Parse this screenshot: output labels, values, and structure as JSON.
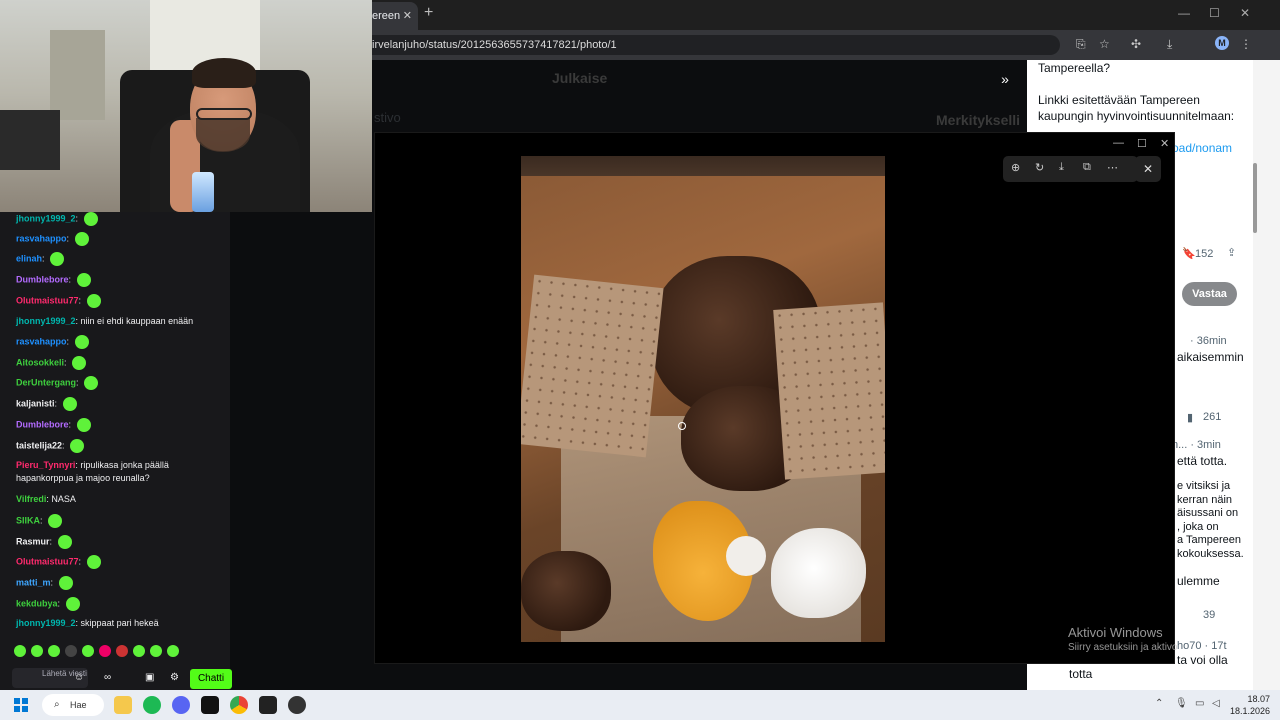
{
  "browser": {
    "tab_title": "ereen",
    "url": "irvelanjuho/status/2012563655737417821/photo/1",
    "avatar_letter": "M"
  },
  "page": {
    "header_left": "Julkaise",
    "header_right": "Merkitykselli",
    "side_text": "stivo"
  },
  "right_panel": {
    "line1": "Tampereella?",
    "line2": "Linkki esitettävään Tampereen kaupungin hyvinvointisuunnitelmaan:",
    "link": "oad/nonam",
    "bookmark_count": "152",
    "follow_button": "Vastaa",
    "reply1_meta": "· 36min",
    "reply1_text": "aikaisemmin",
    "views1": "261",
    "reply2_meta": "n... · 3min",
    "reply2_text": "että totta.",
    "reply3_text": "e vitsiksi ja\nkerran näin\näisussani on\n, joka on\na Tampereen\nkokouksessa.",
    "reply4_text": "ulemme",
    "views2": "39",
    "reply5_meta": "ho70 · 17t",
    "reply5_text": "ta voi olla",
    "reply5_text2": "totta"
  },
  "chat": {
    "messages": [
      {
        "user": "jhonny1999_2",
        "color": "#00b5ad",
        "text": ""
      },
      {
        "user": "rasvahappo",
        "color": "#1e90ff",
        "text": ""
      },
      {
        "user": "elinah",
        "color": "#1e90ff",
        "text": ""
      },
      {
        "user": "Dumblebore",
        "color": "#b36bff",
        "text": ""
      },
      {
        "user": "Olutmaistuu77",
        "color": "#ff2a6d",
        "text": ""
      },
      {
        "user": "jhonny1999_2",
        "color": "#00b5ad",
        "text": "niin ei ehdi kauppaan enään"
      },
      {
        "user": "rasvahappo",
        "color": "#1e90ff",
        "text": ""
      },
      {
        "user": "Aitosokkeli",
        "color": "#3ecf3e",
        "text": ""
      },
      {
        "user": "DerUntergang",
        "color": "#3ecf3e",
        "text": ""
      },
      {
        "user": "kaljanisti",
        "color": "#efeff1",
        "text": ""
      },
      {
        "user": "Dumblebore",
        "color": "#b36bff",
        "text": ""
      },
      {
        "user": "taistelija22",
        "color": "#efeff1",
        "text": ""
      },
      {
        "user": "Pieru_Tynnyri",
        "color": "#ff2a6d",
        "text": "ripulikasa jonka päällä hapankorppua ja majoo reunalla?"
      },
      {
        "user": "Vilfredi",
        "color": "#3ecf3e",
        "text": "NASA"
      },
      {
        "user": "SIIKA",
        "color": "#3ecf3e",
        "text": ""
      },
      {
        "user": "Rasmur",
        "color": "#efeff1",
        "text": ""
      },
      {
        "user": "Olutmaistuu77",
        "color": "#ff2a6d",
        "text": ""
      },
      {
        "user": "matti_m",
        "color": "#3ea6ff",
        "text": ""
      },
      {
        "user": "kekdubya",
        "color": "#3ecf3e",
        "text": ""
      },
      {
        "user": "jhonny1999_2",
        "color": "#00b5ad",
        "text": "skippaat pari hekeä"
      }
    ],
    "input_placeholder": "Lähetä viesti",
    "send_button": "Chatti"
  },
  "windows": {
    "activate_title": "Aktivoi Windows",
    "activate_sub": "Siirry asetuksiin ja aktivo",
    "search_label": "Hae",
    "time": "18.07",
    "date": "18.1.2026"
  }
}
